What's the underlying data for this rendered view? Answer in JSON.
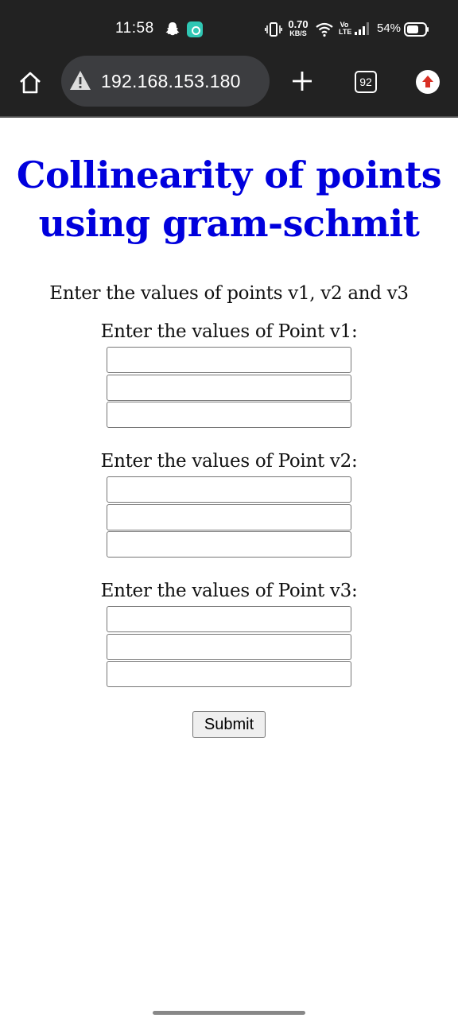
{
  "status_bar": {
    "time": "11:58",
    "net_speed_value": "0.70",
    "net_speed_unit": "KB/S",
    "volte_label": "Vo LTE",
    "battery_percent": "54%",
    "icons": [
      "snapchat-icon",
      "app-notification-icon",
      "vibrate-icon",
      "wifi-icon",
      "signal-icon",
      "battery-icon"
    ]
  },
  "browser": {
    "url": "192.168.153.180",
    "tab_count": "92",
    "icons": [
      "home-icon",
      "not-secure-warning-icon",
      "new-tab-icon",
      "tabs-icon",
      "update-icon"
    ],
    "update_icon_color": "#d93025"
  },
  "page": {
    "title_line1": "Collinearity of points",
    "title_line2": "using gram-schmit",
    "title_color": "#0000dd",
    "intro": "Enter the values of points v1, v2 and v3",
    "points": [
      {
        "label": "Enter the values of Point v1:",
        "values": [
          "",
          "",
          ""
        ]
      },
      {
        "label": "Enter the values of Point v2:",
        "values": [
          "",
          "",
          ""
        ]
      },
      {
        "label": "Enter the values of Point v3:",
        "values": [
          "",
          "",
          ""
        ]
      }
    ],
    "submit_label": "Submit"
  }
}
